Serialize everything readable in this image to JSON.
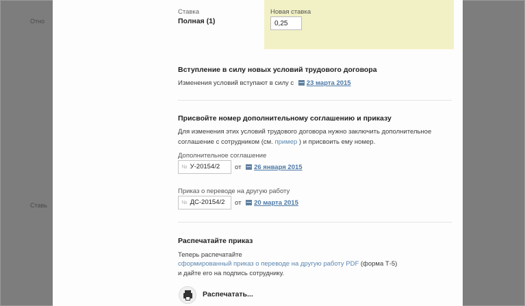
{
  "background": {
    "left_text_1": "Отно",
    "left_text_2": "Ставь"
  },
  "rate": {
    "label": "Ставка",
    "value": "Полная (1)",
    "new_label": "Новая ставка",
    "new_value": "0,25"
  },
  "effective": {
    "title": "Вступление в силу новых условий трудового договора",
    "text": "Изменения условий вступают в силу с",
    "date": "23 марта 2015"
  },
  "numbering": {
    "title": "Присвойте номер дополнительному соглашению и приказу",
    "text_line1": "Для изменения этих условий трудового договора нужно заключить дополнительное",
    "text_line2_pre": "соглашение с сотрудником (см.",
    "text_line2_link": "пример",
    "text_line2_post": ") и присвоить ему номер.",
    "agreement_label": "Дополнительное соглашение",
    "agreement_no_prefix": "№",
    "agreement_number": "У-20154/2",
    "agreement_from": "от",
    "agreement_date": "26 января 2015",
    "order_label": "Приказ о переводе на другую работу",
    "order_no_prefix": "№",
    "order_number": "ДС-20154/2",
    "order_from": "от",
    "order_date": "20 марта 2015"
  },
  "print_section": {
    "title": "Распечатайте приказ",
    "text_line1": "Теперь распечатайте",
    "link": "сформированный приказ о переводе на другую работу PDF",
    "form": "(форма Т-5)",
    "text_line3": "и дайте его на подпись сотруднику.",
    "button_label": "Распечатать..."
  }
}
